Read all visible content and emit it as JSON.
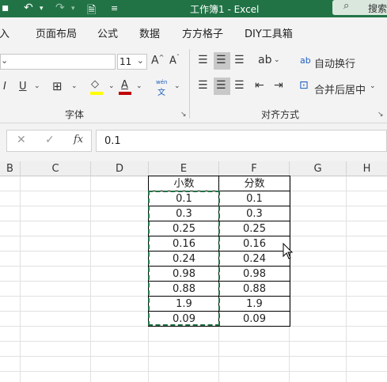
{
  "titlebar": {
    "title": "工作簿1  -  Excel",
    "search_label": "搜索"
  },
  "tabs": [
    "插入",
    "页面布局",
    "公式",
    "数据",
    "方方格子",
    "DIY工具箱"
  ],
  "ribbon": {
    "font_name": "",
    "font_size": "11",
    "wrap_text_label": "自动换行",
    "merge_center_label": "合并后居中",
    "font_group_label": "字体",
    "alignment_group_label": "对齐方式",
    "phonetic_top": "wén",
    "phonetic_bottom": "文"
  },
  "formula_bar": {
    "fx_label": "fx",
    "value": "0.1"
  },
  "columns": [
    "B",
    "C",
    "D",
    "E",
    "F",
    "G",
    "H"
  ],
  "table": {
    "headers": [
      "小数",
      "分数"
    ],
    "rows": [
      [
        "0.1",
        "0.1"
      ],
      [
        "0.3",
        "0.3"
      ],
      [
        "0.25",
        "0.25"
      ],
      [
        "0.16",
        "0.16"
      ],
      [
        "0.24",
        "0.24"
      ],
      [
        "0.98",
        "0.98"
      ],
      [
        "0.88",
        "0.88"
      ],
      [
        "1.9",
        "1.9"
      ],
      [
        "0.09",
        "0.09"
      ]
    ]
  },
  "colors": {
    "accent": "#217346",
    "font_color_underline": "#c00000",
    "fill_color_underline": "#ffff00"
  }
}
